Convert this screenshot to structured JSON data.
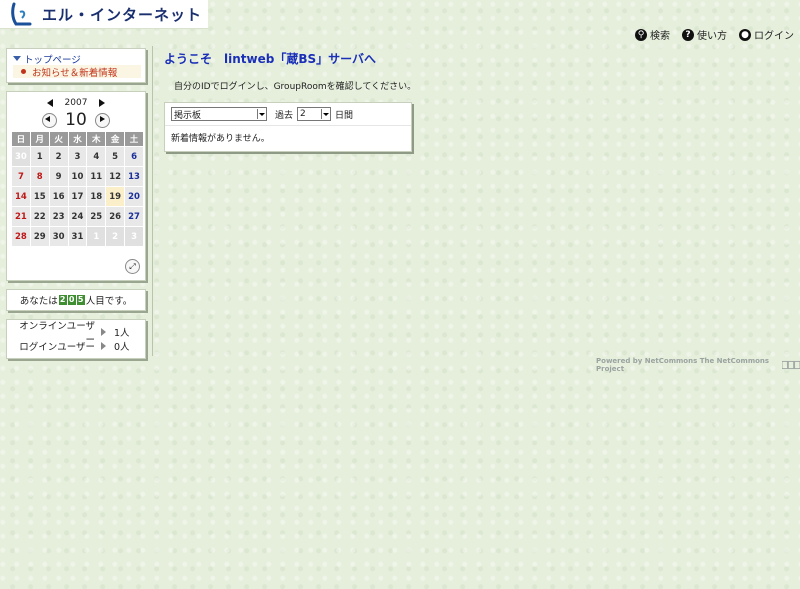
{
  "header": {
    "logo_text": "エル・インターネット",
    "nav": [
      {
        "label": "検索",
        "icon": "search-icon"
      },
      {
        "label": "使い方",
        "icon": "help-icon"
      },
      {
        "label": "ログイン",
        "icon": "user-icon"
      }
    ]
  },
  "menu": {
    "top_page": "トップページ",
    "news": "お知らせ＆新着情報"
  },
  "calendar": {
    "year": "2007",
    "month": "10",
    "weekdays": [
      "日",
      "月",
      "火",
      "水",
      "木",
      "金",
      "土"
    ],
    "weeks": [
      [
        "30",
        "1",
        "2",
        "3",
        "4",
        "5",
        "6"
      ],
      [
        "7",
        "8",
        "9",
        "10",
        "11",
        "12",
        "13"
      ],
      [
        "14",
        "15",
        "16",
        "17",
        "18",
        "19",
        "20"
      ],
      [
        "21",
        "22",
        "23",
        "24",
        "25",
        "26",
        "27"
      ],
      [
        "28",
        "29",
        "30",
        "31",
        "1",
        "2",
        "3"
      ]
    ]
  },
  "visitor": {
    "prefix": "あなたは",
    "digits": [
      "2",
      "0",
      "5"
    ],
    "suffix": "人目です。"
  },
  "online": {
    "online_label": "オンラインユーザー",
    "online_count": "1人",
    "login_label": "ログインユーザー",
    "login_count": "0人"
  },
  "main": {
    "title": "ようこそ　lintweb「蔵BS」サーバへ",
    "intro": "自分のIDでログインし、GroupRoomを確認してください。",
    "module_select": "掲示板",
    "past_label": "過去",
    "days_select": "2",
    "days_unit": "日間",
    "empty_message": "新着情報がありません。"
  },
  "footer": {
    "powered": "Powered by NetCommons  The NetCommons Project"
  },
  "colors": {
    "title_blue": "#1a2fb8",
    "sunday_red": "#c01818",
    "saturday_blue": "#1a2f9a",
    "counter_green": "#3f8f32"
  }
}
